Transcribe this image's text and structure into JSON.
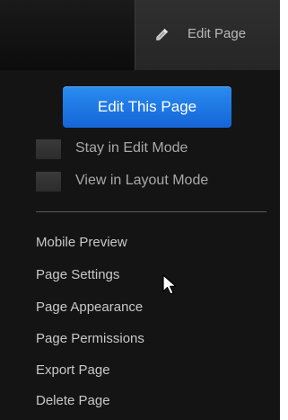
{
  "toolbar": {
    "tab_label": "Edit Page",
    "tab_icon": "pencil-icon"
  },
  "panel": {
    "edit_button_label": "Edit This Page",
    "checkboxes": [
      {
        "label": "Stay in Edit Mode",
        "checked": false
      },
      {
        "label": "View in Layout Mode",
        "checked": false
      }
    ],
    "menu_items": [
      {
        "label": "Mobile Preview"
      },
      {
        "label": "Page Settings"
      },
      {
        "label": "Page Appearance"
      },
      {
        "label": "Page Permissions"
      },
      {
        "label": "Export Page"
      },
      {
        "label": "Delete Page"
      }
    ]
  },
  "colors": {
    "panel_bg": "#141414",
    "button_blue": "#1f78e6",
    "menu_text": "#c8c8c8",
    "checkbox_text": "#a9a9a9"
  }
}
